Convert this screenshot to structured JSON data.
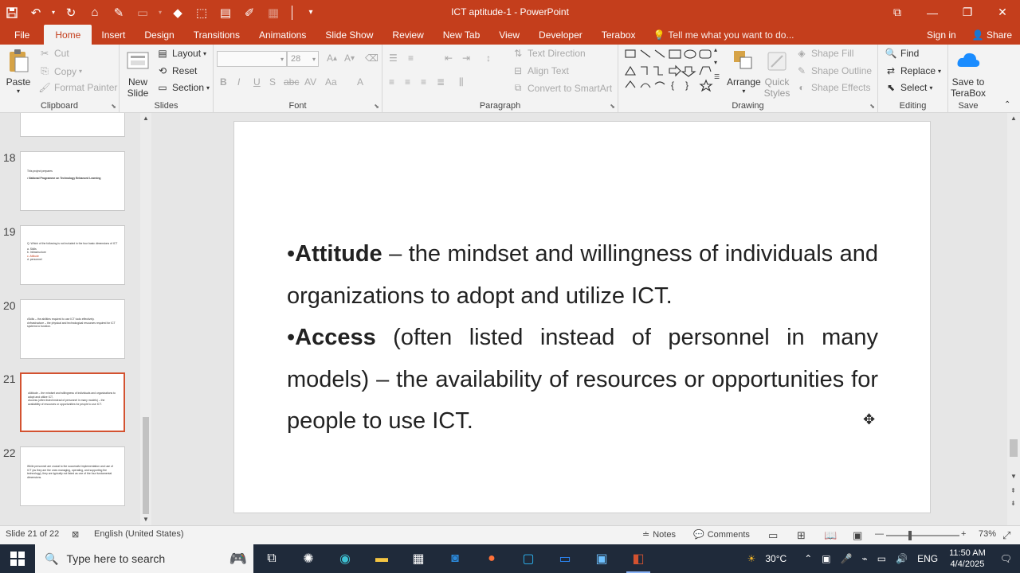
{
  "window": {
    "title": "ICT aptitude-1 - PowerPoint"
  },
  "tabs": [
    {
      "label": "File"
    },
    {
      "label": "Home"
    },
    {
      "label": "Insert"
    },
    {
      "label": "Design"
    },
    {
      "label": "Transitions"
    },
    {
      "label": "Animations"
    },
    {
      "label": "Slide Show"
    },
    {
      "label": "Review"
    },
    {
      "label": "New Tab"
    },
    {
      "label": "View"
    },
    {
      "label": "Developer"
    },
    {
      "label": "Terabox"
    }
  ],
  "tellme": "Tell me what you want to do...",
  "signin": "Sign in",
  "share": "Share",
  "ribbon": {
    "clipboard": {
      "label": "Clipboard",
      "paste": "Paste",
      "cut": "Cut",
      "copy": "Copy",
      "format_painter": "Format Painter"
    },
    "slides": {
      "label": "Slides",
      "new_slide_1": "New",
      "new_slide_2": "Slide",
      "layout": "Layout",
      "reset": "Reset",
      "section": "Section"
    },
    "font": {
      "label": "Font",
      "size": "28"
    },
    "paragraph": {
      "label": "Paragraph",
      "text_direction": "Text Direction",
      "align_text": "Align Text",
      "convert_smartart": "Convert to SmartArt"
    },
    "drawing": {
      "label": "Drawing",
      "arrange": "Arrange",
      "quick_styles_1": "Quick",
      "quick_styles_2": "Styles",
      "shape_fill": "Shape Fill",
      "shape_outline": "Shape Outline",
      "shape_effects": "Shape Effects"
    },
    "editing": {
      "label": "Editing",
      "find": "Find",
      "replace": "Replace",
      "select": "Select"
    },
    "save": {
      "label": "Save",
      "save_terabox_1": "Save to",
      "save_terabox_2": "TeraBox"
    }
  },
  "thumbnails": [
    {
      "num": "18",
      "lines": [
        "This project prepares",
        "• National Programme on Technology Enhanced Learning"
      ]
    },
    {
      "num": "19",
      "lines": [
        "Q. Which of the following is not included in the four basic dimensions of ICT",
        "a.   Skills",
        "b.   Infrastructure",
        "c.   Attitude",
        "d.   personnel"
      ]
    },
    {
      "num": "20",
      "lines": [
        "•Skills – the abilities required to use ICT tools effectively.",
        "•Infrastructure – the physical and technological resources required for ICT systems to function."
      ]
    },
    {
      "num": "21",
      "lines": [
        "•Attitude – the mindset and willingness of individuals and organizations to adopt and utilize ICT.",
        "•Access (often listed instead of personnel in many models) – the availability of resources or opportunities for people to use ICT."
      ]
    },
    {
      "num": "22",
      "lines": [
        "While personnel are crucial to the successful implementation and use of ICT (as they are the ones managing, operating, and supporting the technology), they are typically not listed as one of the four fundamental dimensions."
      ]
    }
  ],
  "slide": {
    "p1_bold": "Attitude",
    "p1_rest": " – the mindset and willingness of individuals and organizations to adopt and utilize ICT.",
    "p2_bold": "Access",
    "p2_rest": " (often listed instead of personnel in many models) – the availability of resources or opportunities for people to use ICT."
  },
  "status": {
    "slide_of": "Slide 21 of 22",
    "language": "English (United States)",
    "notes": "Notes",
    "comments": "Comments",
    "zoom": "73%"
  },
  "taskbar": {
    "search_placeholder": "Type here to search",
    "temperature": "30°C",
    "language": "ENG",
    "time": "11:50 AM",
    "date": "4/4/2025"
  },
  "colors": {
    "accent": "#c43e1c",
    "taskbar": "#1f2a3a"
  }
}
